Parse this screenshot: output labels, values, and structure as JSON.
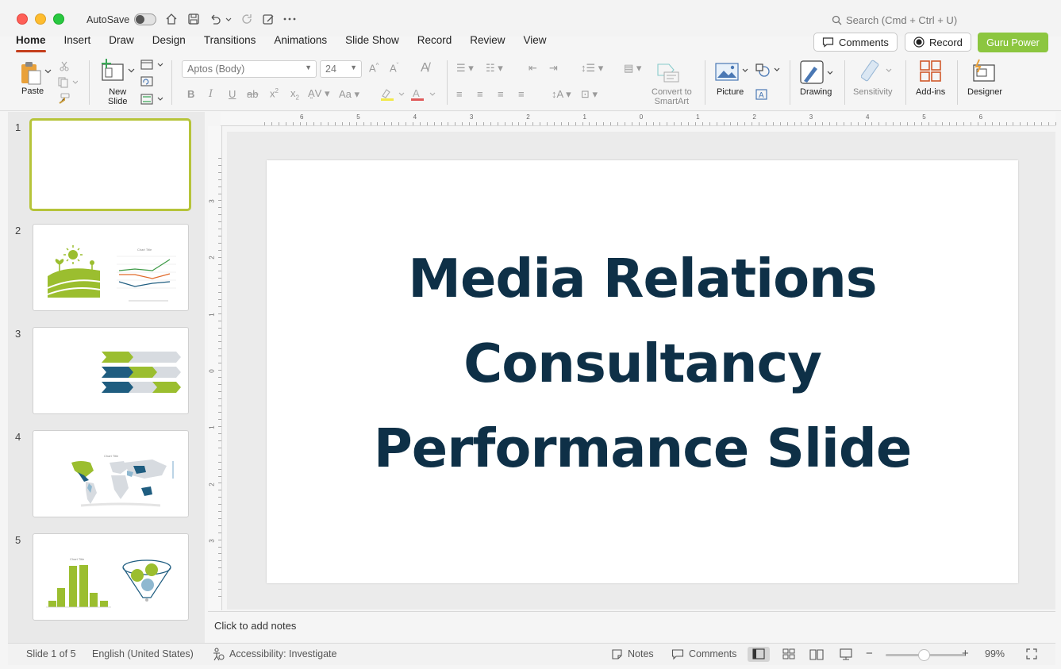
{
  "titlebar": {
    "autosave_label": "AutoSave",
    "search_placeholder": "Search (Cmd + Ctrl + U)"
  },
  "tabs": [
    "Home",
    "Insert",
    "Draw",
    "Design",
    "Transitions",
    "Animations",
    "Slide Show",
    "Record",
    "Review",
    "View"
  ],
  "header_buttons": {
    "comments": "Comments",
    "record": "Record",
    "guru": "Guru Power"
  },
  "ribbon": {
    "paste": "Paste",
    "new_slide_line1": "New",
    "new_slide_line2": "Slide",
    "font_name": "Aptos (Body)",
    "font_size": "24",
    "convert_line1": "Convert to",
    "convert_line2": "SmartArt",
    "picture": "Picture",
    "drawing": "Drawing",
    "sensitivity": "Sensitivity",
    "addins": "Add-ins",
    "designer": "Designer"
  },
  "slides": [
    {
      "number": "1"
    },
    {
      "number": "2"
    },
    {
      "number": "3"
    },
    {
      "number": "4"
    },
    {
      "number": "5"
    }
  ],
  "slide": {
    "title_line1": "Media Relations",
    "title_line2": "Consultancy",
    "title_line3": "Performance Slide"
  },
  "ruler": {
    "h_labels": [
      "6",
      "5",
      "4",
      "3",
      "2",
      "1",
      "0",
      "1",
      "2",
      "3",
      "4",
      "5",
      "6"
    ],
    "v_labels": [
      "3",
      "2",
      "1",
      "0",
      "1",
      "2",
      "3"
    ]
  },
  "notes_placeholder": "Click to add notes",
  "statusbar": {
    "slide_count": "Slide 1 of 5",
    "language": "English (United States)",
    "accessibility": "Accessibility: Investigate",
    "notes": "Notes",
    "comments": "Comments",
    "zoom": "99%"
  },
  "colors": {
    "accent_red": "#c43e1c",
    "guru_green": "#8cc63f",
    "title_navy": "#0e3047",
    "thumb_green": "#9bbe2f",
    "thumb_blue": "#1f5d80"
  }
}
